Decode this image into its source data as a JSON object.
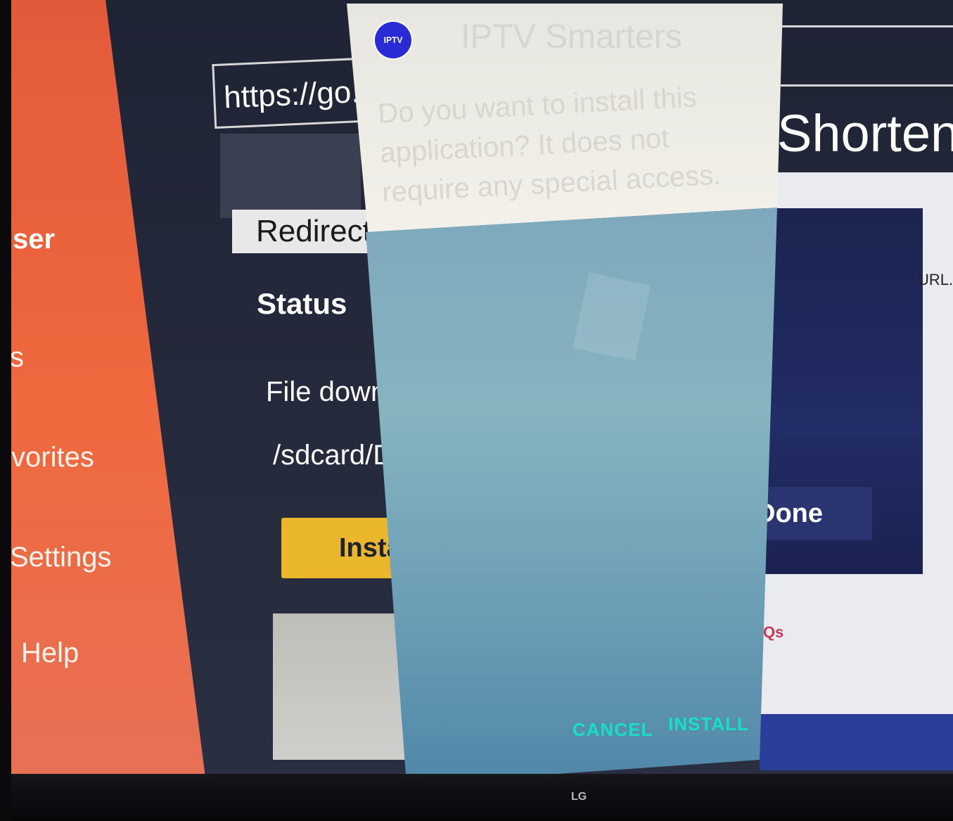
{
  "sidebar": {
    "items": [
      {
        "label": "ser",
        "active": true
      },
      {
        "label": "s"
      },
      {
        "label": "vorites"
      },
      {
        "label": "Settings"
      },
      {
        "label": "Help"
      }
    ]
  },
  "browser": {
    "url_text": "https://go.",
    "shorten_label": "Shorten",
    "redirect_label": "Redirect",
    "status_heading": "Status",
    "file_download_text": "File downl",
    "file_path_text": "/sdcard/D",
    "install_button_label": "Insta",
    "done_button_label": "Done",
    "url_note": "URL.",
    "faq_link": "Qs"
  },
  "dialog": {
    "app_icon_text": "IPTV",
    "app_name": "IPTV Smarters",
    "prompt": "Do you want to install this application? It does not require any special access.",
    "cancel_label": "CANCEL",
    "install_label": "INSTALL"
  },
  "tv": {
    "brand": "LG"
  },
  "colors": {
    "sidebar_orange": "#f0683d",
    "button_yellow": "#e9b62c",
    "dialog_button_teal": "#15e0c5",
    "dialog_body_blue": "#86b4bf"
  }
}
